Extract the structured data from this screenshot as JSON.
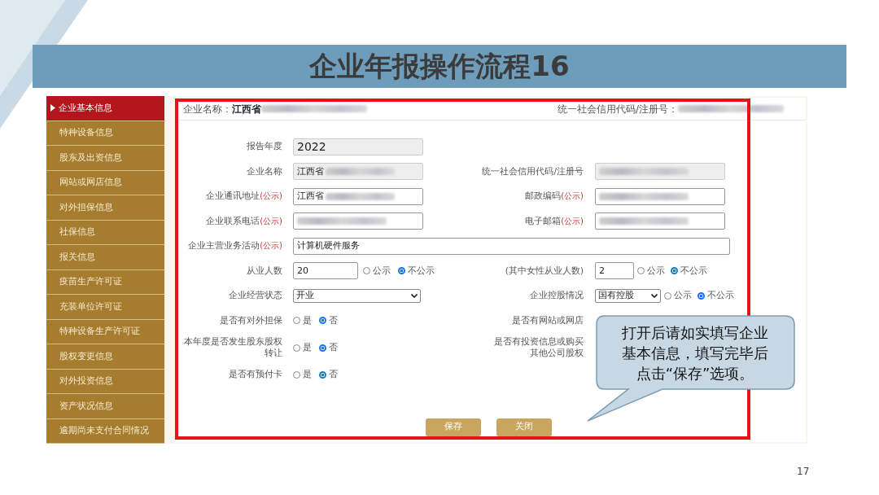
{
  "slide_title": "企业年报操作流程16",
  "sidebar": {
    "items": [
      {
        "label": "企业基本信息",
        "selected": true
      },
      {
        "label": "特种设备信息",
        "selected": false
      },
      {
        "label": "股东及出资信息",
        "selected": false
      },
      {
        "label": "网站或网店信息",
        "selected": false
      },
      {
        "label": "对外担保信息",
        "selected": false
      },
      {
        "label": "社保信息",
        "selected": false
      },
      {
        "label": "报关信息",
        "selected": false
      },
      {
        "label": "疫苗生产许可证",
        "selected": false
      },
      {
        "label": "充装单位许可证",
        "selected": false
      },
      {
        "label": "特种设备生产许可证",
        "selected": false
      },
      {
        "label": "股权变更信息",
        "selected": false
      },
      {
        "label": "对外投资信息",
        "selected": false
      },
      {
        "label": "资产状况信息",
        "selected": false
      },
      {
        "label": "逾期尚未支付合同情况",
        "selected": false
      }
    ]
  },
  "header": {
    "company_label": "企业名称：",
    "company_value": "江西省",
    "company_redacted": true,
    "code_label": "统一社会信用代码/注册号：",
    "code_redacted": true
  },
  "rows": [
    {
      "left": {
        "label": "报告年度",
        "kind": "text",
        "value": "2022",
        "readonly": true
      }
    },
    {
      "left": {
        "label": "企业名称",
        "kind": "text",
        "value": "江西省",
        "redacted": true,
        "readonly": true
      },
      "right": {
        "label": "统一社会信用代码/注册号",
        "kind": "text",
        "redacted": true,
        "readonly": true
      }
    },
    {
      "left": {
        "label": "企业通讯地址",
        "tag": "(公示)",
        "kind": "text",
        "value": "江西省",
        "redacted": true,
        "readonly": false
      },
      "right": {
        "label": "邮政编码",
        "tag": "(公示)",
        "kind": "text",
        "redacted": true,
        "readonly": false
      }
    },
    {
      "left": {
        "label": "企业联系电话",
        "tag": "(公示)",
        "kind": "text",
        "redacted": true,
        "readonly": false
      },
      "right": {
        "label": "电子邮箱",
        "tag": "(公示)",
        "kind": "text",
        "redacted": true,
        "readonly": false
      }
    },
    {
      "left": {
        "label": "企业主营业务活动",
        "tag": "(公示)",
        "kind": "wide_text",
        "value": "计算机硬件服务",
        "readonly": false
      }
    },
    {
      "left": {
        "label": "从业人数",
        "kind": "text",
        "value": "20",
        "readonly": false,
        "options": [
          {
            "label": "公示",
            "selected": false
          },
          {
            "label": "不公示",
            "selected": true
          }
        ]
      },
      "right": {
        "label": "(其中女性从业人数)",
        "kind": "text",
        "value": "2",
        "readonly": false,
        "options": [
          {
            "label": "公示",
            "selected": false
          },
          {
            "label": "不公示",
            "selected": true
          }
        ]
      }
    },
    {
      "left": {
        "label": "企业经营状态",
        "kind": "select",
        "value": "开业"
      },
      "right": {
        "label": "企业控股情况",
        "kind": "select",
        "value": "国有控股",
        "options": [
          {
            "label": "公示",
            "selected": false
          },
          {
            "label": "不公示",
            "selected": true
          }
        ]
      }
    },
    {
      "left": {
        "label": "是否有对外担保",
        "kind": "radio",
        "options": [
          {
            "label": "是",
            "selected": false
          },
          {
            "label": "否",
            "selected": true
          }
        ]
      },
      "right": {
        "label": "是否有网站或网店",
        "kind": "covered"
      }
    },
    {
      "left": {
        "label": "本年度是否发生股东股权转让",
        "kind": "radio",
        "options": [
          {
            "label": "是",
            "selected": false
          },
          {
            "label": "否",
            "selected": true
          }
        ]
      },
      "right": {
        "label": "是否有投资信息或购买其他公司股权",
        "kind": "covered"
      }
    },
    {
      "left": {
        "label": "是否有预付卡",
        "kind": "radio",
        "options": [
          {
            "label": "是",
            "selected": false
          },
          {
            "label": "否",
            "selected": true
          }
        ]
      }
    }
  ],
  "buttons": [
    "保存",
    "关闭"
  ],
  "callout": "打开后请如实填写企业基本信息，填写完毕后点击“保存”选项。",
  "page_number": "17"
}
